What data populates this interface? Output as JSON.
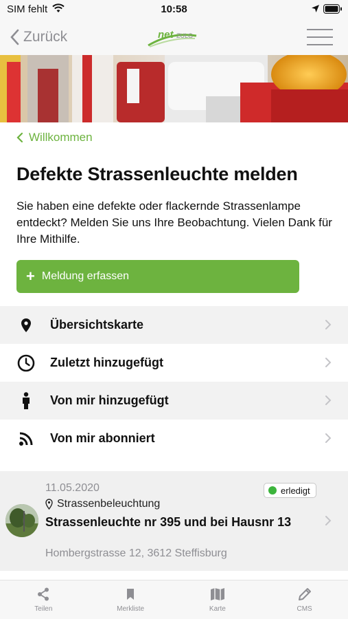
{
  "status_bar": {
    "carrier": "SIM fehlt",
    "time": "10:58"
  },
  "nav": {
    "back_label": "Zurück",
    "logo_text_bold": "net",
    "logo_text_small": "ZULG",
    "menu_icon": "hamburger-icon"
  },
  "breadcrumb": {
    "label": "Willkommen"
  },
  "page": {
    "title": "Defekte Strassenleuchte melden",
    "intro": "Sie haben eine defekte oder flackernde Strassenlampe entdeckt? Melden Sie uns Ihre Beobachtung. Vielen Dank für Ihre Mithilfe.",
    "cta_label": "Meldung erfassen"
  },
  "menu": {
    "items": [
      {
        "label": "Übersichtskarte",
        "icon": "map-pin-icon"
      },
      {
        "label": "Zuletzt hinzugefügt",
        "icon": "clock-icon"
      },
      {
        "label": "Von mir hinzugefügt",
        "icon": "person-icon"
      },
      {
        "label": "Von mir abonniert",
        "icon": "rss-icon"
      }
    ]
  },
  "report": {
    "date": "11.05.2020",
    "status": "erledigt",
    "category": "Strassenbeleuchtung",
    "title": "Strassenleuchte nr 395 und bei Hausnr 13",
    "address": "Hombergstrasse 12, 3612 Steffisburg"
  },
  "tabs": [
    {
      "label": "Teilen",
      "icon": "share-icon"
    },
    {
      "label": "Merkliste",
      "icon": "bookmark-icon"
    },
    {
      "label": "Karte",
      "icon": "map-icon"
    },
    {
      "label": "CMS",
      "icon": "pencil-icon"
    }
  ],
  "colors": {
    "accent": "#6db33f",
    "status_done": "#3cb43c",
    "muted": "#8e8e93"
  }
}
